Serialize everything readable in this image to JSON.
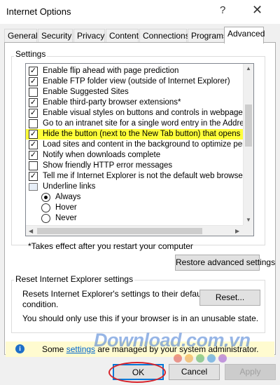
{
  "window": {
    "title": "Internet Options",
    "help_glyph": "?",
    "close_glyph": "✕"
  },
  "tabs": [
    {
      "label": "General",
      "active": false
    },
    {
      "label": "Security",
      "active": false
    },
    {
      "label": "Privacy",
      "active": false
    },
    {
      "label": "Content",
      "active": false
    },
    {
      "label": "Connections",
      "active": false
    },
    {
      "label": "Programs",
      "active": false
    },
    {
      "label": "Advanced",
      "active": true
    }
  ],
  "settings": {
    "group_label": "Settings",
    "items": [
      {
        "type": "checkbox",
        "checked": true,
        "label": "Enable flip ahead with page prediction"
      },
      {
        "type": "checkbox",
        "checked": true,
        "label": "Enable FTP folder view (outside of Internet Explorer)"
      },
      {
        "type": "checkbox",
        "checked": false,
        "label": "Enable Suggested Sites"
      },
      {
        "type": "checkbox",
        "checked": true,
        "label": "Enable third-party browser extensions*"
      },
      {
        "type": "checkbox",
        "checked": true,
        "label": "Enable visual styles on buttons and controls in webpages"
      },
      {
        "type": "checkbox",
        "checked": false,
        "label": "Go to an intranet site for a single word entry in the Address"
      },
      {
        "type": "checkbox",
        "checked": true,
        "highlighted": true,
        "label": "Hide the button (next to the New Tab button) that opens Mic"
      },
      {
        "type": "checkbox",
        "checked": true,
        "label": "Load sites and content in the background to optimize perforn"
      },
      {
        "type": "checkbox",
        "checked": true,
        "label": "Notify when downloads complete"
      },
      {
        "type": "checkbox",
        "checked": false,
        "label": "Show friendly HTTP error messages"
      },
      {
        "type": "checkbox",
        "checked": true,
        "label": "Tell me if Internet Explorer is not the default web browser"
      },
      {
        "type": "group",
        "label": "Underline links"
      },
      {
        "type": "radio",
        "selected": true,
        "label": "Always"
      },
      {
        "type": "radio",
        "selected": false,
        "label": "Hover"
      },
      {
        "type": "radio",
        "selected": false,
        "label": "Never"
      }
    ],
    "footnote": "*Takes effect after you restart your computer",
    "restore_button": "Restore advanced settings"
  },
  "reset": {
    "group_label": "Reset Internet Explorer settings",
    "description_line1": "Resets Internet Explorer's settings to their default",
    "description_line2": "condition.",
    "warning": "You should only use this if your browser is in an unusable state.",
    "button": "Reset..."
  },
  "info_bar": {
    "prefix": "Some ",
    "link": "settings",
    "suffix": " are managed by your system administrator.",
    "icon_letter": "i"
  },
  "watermark": {
    "text": "Download.com.vn",
    "dot_colors": [
      "#e24b3b",
      "#f3a32b",
      "#4caf50",
      "#2f8fd8",
      "#9c4dcc"
    ]
  },
  "footer": {
    "ok": "OK",
    "cancel": "Cancel",
    "apply": "Apply"
  },
  "colors": {
    "highlight": "#ffff3a",
    "annotation_ring": "#d8232a",
    "accent": "#0078d7"
  }
}
